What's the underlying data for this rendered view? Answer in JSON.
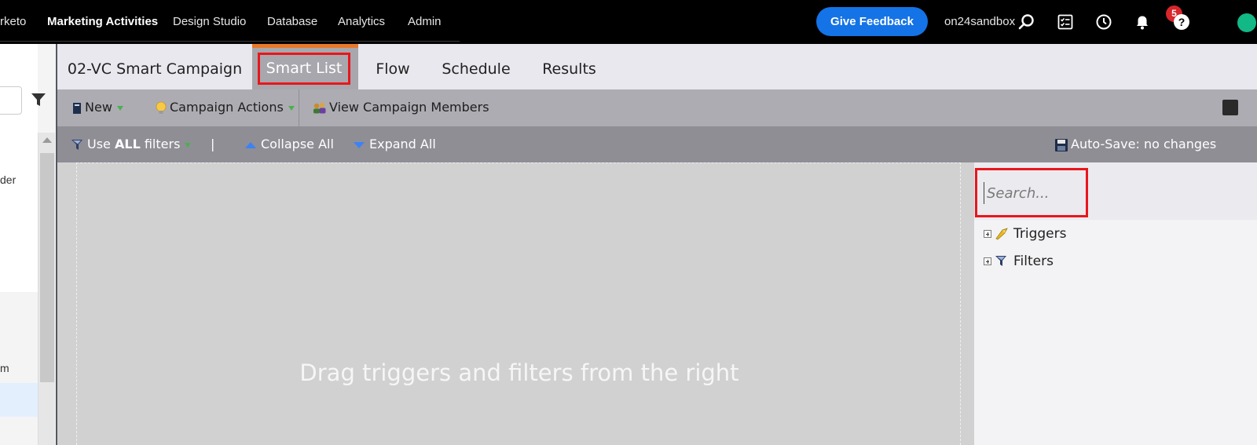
{
  "topnav": {
    "items": [
      {
        "label": "rketo",
        "active": false
      },
      {
        "label": "Marketing Activities",
        "active": true
      },
      {
        "label": "Design Studio",
        "active": false
      },
      {
        "label": "Database",
        "active": false
      },
      {
        "label": "Analytics",
        "active": false
      },
      {
        "label": "Admin",
        "active": false
      }
    ],
    "feedback_label": "Give Feedback",
    "user": "on24sandbox",
    "notification_count": "5",
    "icons": [
      "search-icon",
      "checklist-icon",
      "clock-icon",
      "bell-icon",
      "help-icon",
      "avatar"
    ]
  },
  "leftpanel": {
    "text_fragments": [
      "der",
      "m"
    ]
  },
  "tabs": [
    {
      "label": "02-VC Smart Campaign",
      "active": false
    },
    {
      "label": "Smart List",
      "active": true
    },
    {
      "label": "Flow",
      "active": false
    },
    {
      "label": "Schedule",
      "active": false
    },
    {
      "label": "Results",
      "active": false
    }
  ],
  "toolbar": {
    "new_label": "New",
    "campaign_actions_label": "Campaign Actions",
    "view_members_label": "View Campaign Members"
  },
  "filterbar": {
    "use_prefix": "Use ",
    "use_bold": "ALL",
    "use_suffix": " filters",
    "separator": "|",
    "collapse_label": "Collapse All",
    "expand_label": "Expand All",
    "autosave_label": "Auto-Save: no changes"
  },
  "canvas": {
    "drop_text": "Drag triggers and filters from the right"
  },
  "rightpanel": {
    "search_placeholder": "Search...",
    "tree": [
      {
        "label": "Triggers",
        "icon": "trigger-icon"
      },
      {
        "label": "Filters",
        "icon": "filter-icon"
      }
    ]
  },
  "colors": {
    "accent_orange": "#e8792a",
    "feedback_blue": "#1473e6",
    "badge_red": "#d7262c",
    "highlight_red": "#e8161c"
  }
}
